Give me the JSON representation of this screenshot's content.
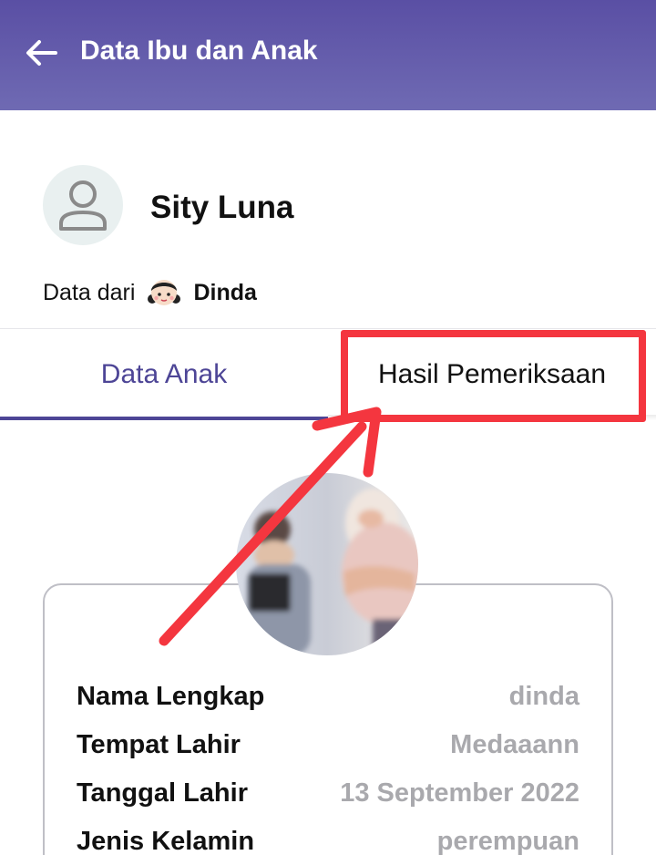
{
  "header": {
    "title": "Data Ibu dan Anak"
  },
  "profile": {
    "name": "Sity Luna"
  },
  "source": {
    "label": "Data dari",
    "name": "Dinda"
  },
  "tabs": [
    {
      "label": "Data Anak",
      "active": true
    },
    {
      "label": "Hasil Pemeriksaan",
      "active": false
    }
  ],
  "details": [
    {
      "label": "Nama Lengkap",
      "value": "dinda"
    },
    {
      "label": "Tempat Lahir",
      "value": "Medaaann"
    },
    {
      "label": "Tanggal Lahir",
      "value": "13 September 2022"
    },
    {
      "label": "Jenis Kelamin",
      "value": "perempuan"
    }
  ],
  "colors": {
    "primary": "#5a4fa4",
    "annotation": "#f4363f",
    "muted_value": "#a9a9ad"
  }
}
